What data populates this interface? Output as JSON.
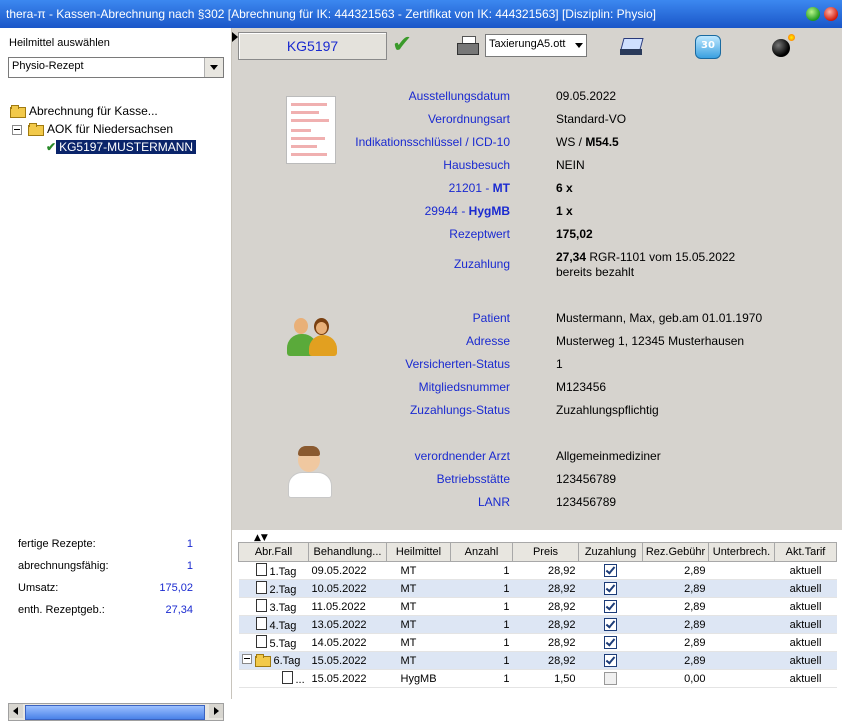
{
  "window": {
    "title": "thera-π  - Kassen-Abrechnung nach §302  [Abrechnung für IK: 444321563 - Zertifikat von IK: 444321563] [Disziplin: Physio]"
  },
  "sidebar": {
    "heilmittel_label": "Heilmittel auswählen",
    "heilmittel_value": "Physio-Rezept",
    "tree": {
      "root": "Abrechnung für Kasse...",
      "kasse": "AOK  für Niedersachsen",
      "rezept": "KG5197-MUSTERMANN"
    },
    "stats": [
      {
        "label": "fertige Rezepte:",
        "value": "1"
      },
      {
        "label": "abrechnungsfähig:",
        "value": "1"
      },
      {
        "label": "Umsatz:",
        "value": "175,02"
      },
      {
        "label": "enth. Rezeptgeb.:",
        "value": "27,34"
      }
    ]
  },
  "toolbar": {
    "rezept_nr": "KG5197",
    "taxierung": "TaxierungA5.ott",
    "badge": "30"
  },
  "rezept": {
    "ausstellungsdatum_label": "Ausstellungsdatum",
    "ausstellungsdatum": "09.05.2022",
    "verordnungsart_label": "Verordnungsart",
    "verordnungsart": "Standard-VO",
    "icd_label": "Indikationsschlüssel / ICD-10",
    "icd_prefix": "WS / ",
    "icd_code": "M54.5",
    "hausbesuch_label": "Hausbesuch",
    "hausbesuch": "NEIN",
    "pos1_code": "21201 - ",
    "pos1_name": "MT",
    "pos1_value": "6 x",
    "pos2_code": "29944 - ",
    "pos2_name": "HygMB",
    "pos2_value": "1 x",
    "rezeptwert_label": "Rezeptwert",
    "rezeptwert": "175,02",
    "zuzahlung_label": "Zuzahlung",
    "zuzahlung_amount": "27,34",
    "zuzahlung_text": " RGR-1101 vom 15.05.2022",
    "zuzahlung_status": "bereits bezahlt"
  },
  "patient": {
    "patient_label": "Patient",
    "patient": "Mustermann, Max, geb.am 01.01.1970",
    "adresse_label": "Adresse",
    "adresse": "Musterweg 1, 12345 Musterhausen",
    "vstatus_label": "Versicherten-Status",
    "vstatus": "1",
    "mitglied_label": "Mitgliedsnummer",
    "mitglied": "M123456",
    "zstatus_label": "Zuzahlungs-Status",
    "zstatus": "Zuzahlungspflichtig"
  },
  "arzt": {
    "arzt_label": "verordnender Arzt",
    "arzt": "Allgemeinmediziner",
    "bst_label": "Betriebsstätte",
    "bst": "123456789",
    "lanr_label": "LANR",
    "lanr": "123456789"
  },
  "grid": {
    "columns": [
      "Abr.Fall",
      "Behandlung...",
      "Heilmittel",
      "Anzahl",
      "Preis",
      "Zuzahlung",
      "Rez.Gebühr",
      "Unterbrech.",
      "Akt.Tarif"
    ],
    "rows": [
      {
        "fall": "1.Tag",
        "datum": "09.05.2022",
        "heilmittel": "MT",
        "anzahl": "1",
        "preis": "28,92",
        "zuzahlung": true,
        "gebuehr": "2,89",
        "unterbrech": "",
        "tarif": "aktuell"
      },
      {
        "fall": "2.Tag",
        "datum": "10.05.2022",
        "heilmittel": "MT",
        "anzahl": "1",
        "preis": "28,92",
        "zuzahlung": true,
        "gebuehr": "2,89",
        "unterbrech": "",
        "tarif": "aktuell"
      },
      {
        "fall": "3.Tag",
        "datum": "11.05.2022",
        "heilmittel": "MT",
        "anzahl": "1",
        "preis": "28,92",
        "zuzahlung": true,
        "gebuehr": "2,89",
        "unterbrech": "",
        "tarif": "aktuell"
      },
      {
        "fall": "4.Tag",
        "datum": "13.05.2022",
        "heilmittel": "MT",
        "anzahl": "1",
        "preis": "28,92",
        "zuzahlung": true,
        "gebuehr": "2,89",
        "unterbrech": "",
        "tarif": "aktuell"
      },
      {
        "fall": "5.Tag",
        "datum": "14.05.2022",
        "heilmittel": "MT",
        "anzahl": "1",
        "preis": "28,92",
        "zuzahlung": true,
        "gebuehr": "2,89",
        "unterbrech": "",
        "tarif": "aktuell"
      },
      {
        "fall": "6.Tag",
        "datum": "15.05.2022",
        "heilmittel": "MT",
        "anzahl": "1",
        "preis": "28,92",
        "zuzahlung": true,
        "gebuehr": "2,89",
        "unterbrech": "",
        "tarif": "aktuell"
      },
      {
        "fall": "...",
        "datum": "15.05.2022",
        "heilmittel": "HygMB",
        "anzahl": "1",
        "preis": "1,50",
        "zuzahlung": false,
        "gebuehr": "0,00",
        "unterbrech": "",
        "tarif": "aktuell"
      }
    ]
  },
  "colors": {
    "accent": "#1a2ad0",
    "selection": "#0a246a",
    "panel": "#d6d3ce",
    "row_alt": "#dde6f4"
  }
}
